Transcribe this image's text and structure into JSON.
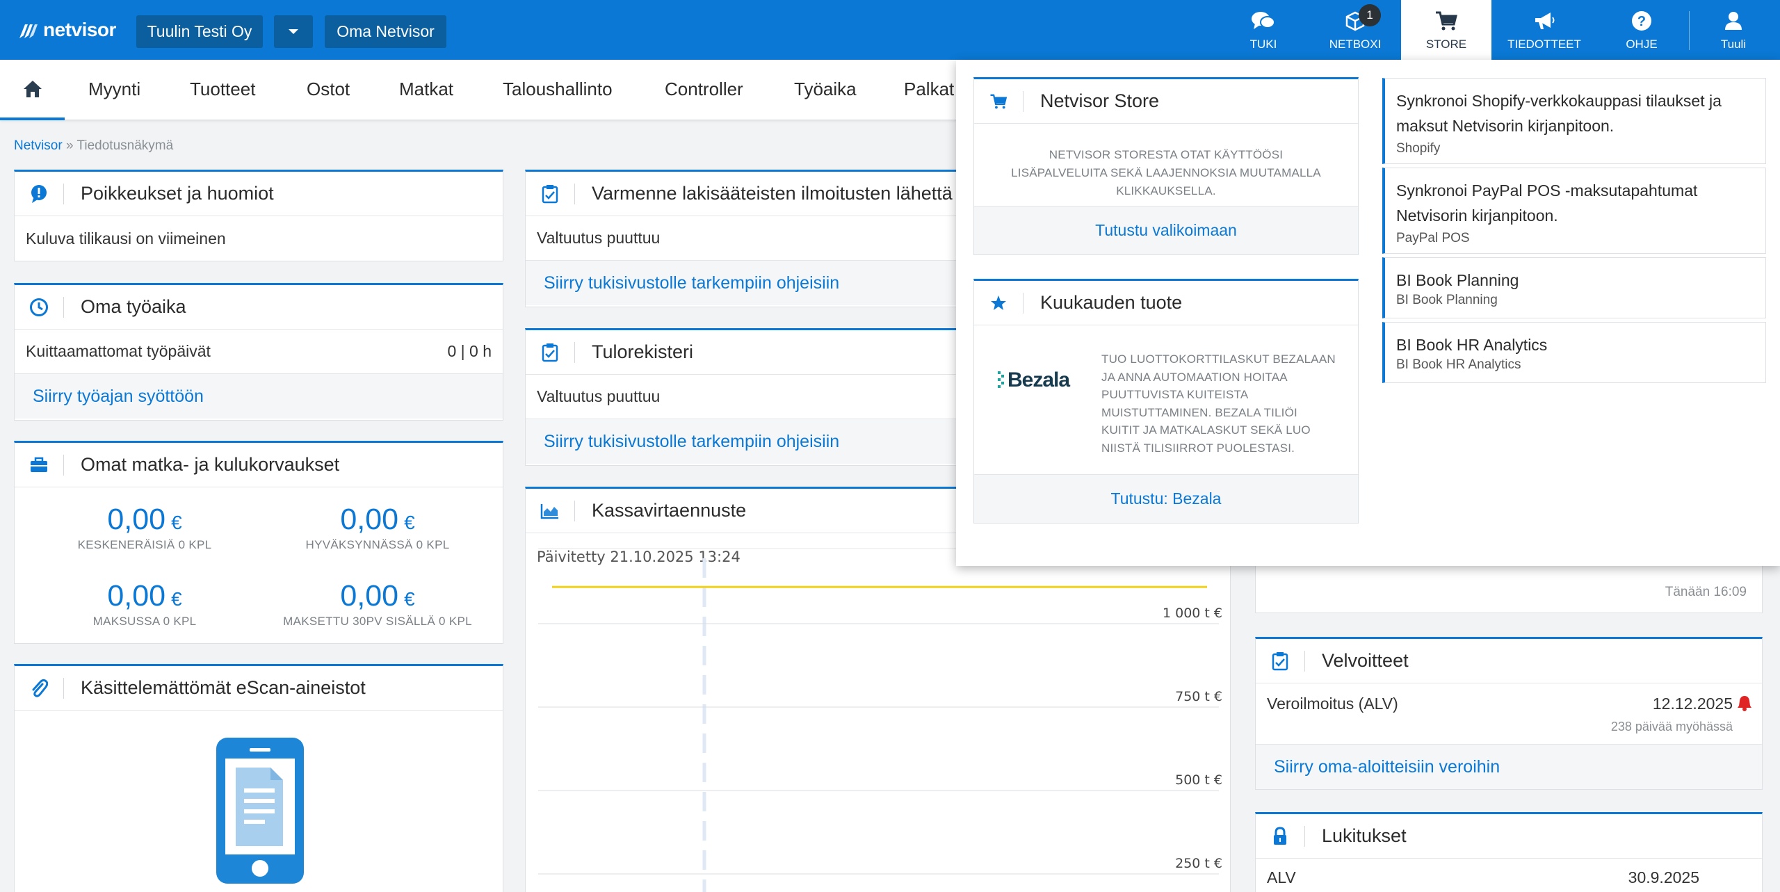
{
  "topbar": {
    "brand": "netvisor",
    "company": "Tuulin Testi Oy",
    "oma_netvisor": "Oma Netvisor",
    "nav": [
      {
        "id": "tuki",
        "label": "TUKI",
        "icon": "chat-bubbles-icon"
      },
      {
        "id": "netboxi",
        "label": "NETBOXI",
        "icon": "box-icon",
        "badge": "1"
      },
      {
        "id": "store",
        "label": "STORE",
        "icon": "cart-icon"
      },
      {
        "id": "tiedotteet",
        "label": "TIEDOTTEET",
        "icon": "megaphone-icon"
      },
      {
        "id": "ohje",
        "label": "OHJE",
        "icon": "help-icon"
      },
      {
        "id": "tuuli",
        "label": "Tuuli",
        "icon": "user-icon"
      }
    ]
  },
  "menu": [
    "Myynti",
    "Tuotteet",
    "Ostot",
    "Matkat",
    "Taloushallinto",
    "Controller",
    "Työaika",
    "Palkat"
  ],
  "breadcrumb": {
    "root": "Netvisor",
    "separator": "»",
    "current": "Tiedotusnäkymä"
  },
  "poikkeukset": {
    "title": "Poikkeukset ja huomiot",
    "row": "Kuluva tilikausi on viimeinen"
  },
  "tyoaika": {
    "title": "Oma työaika",
    "row_label": "Kuittaamattomat työpäivät",
    "row_value": "0 | 0 h",
    "link": "Siirry työajan syöttöön"
  },
  "kulukorvaukset": {
    "title": "Omat matka- ja kulukorvaukset",
    "currency": "€",
    "items": [
      {
        "amount": "0,00",
        "label": "KESKENERÄISIÄ 0 KPL"
      },
      {
        "amount": "0,00",
        "label": "HYVÄKSYNNÄSSÄ 0 KPL"
      },
      {
        "amount": "0,00",
        "label": "MAKSUSSA 0 KPL"
      },
      {
        "amount": "0,00",
        "label": "MAKSETTU 30PV SISÄLLÄ 0 KPL"
      }
    ]
  },
  "escan": {
    "title": "Käsittelemättömät eScan-aineistot"
  },
  "varmenne": {
    "title": "Varmenne lakisääteisten ilmoitusten lähettä",
    "row": "Valtuutus puuttuu",
    "link": "Siirry tukisivustolle tarkempiin ohjeisiin"
  },
  "tulorekisteri": {
    "title": "Tulorekisteri",
    "row": "Valtuutus puuttuu",
    "link": "Siirry tukisivustolle tarkempiin ohjeisiin"
  },
  "kassavirta": {
    "title": "Kassavirtaennuste",
    "updated": "Päivitetty 21.10.2025 13:24"
  },
  "chart_data": {
    "type": "line",
    "title": "Kassavirtaennuste",
    "y_tick_labels": [
      "1 000 t €",
      "750 t €",
      "500 t €",
      "250 t €"
    ],
    "y_ticks": [
      1000,
      750,
      500,
      250
    ],
    "series": [
      {
        "values": [
          1110,
          1110
        ],
        "color": "#f2d21b"
      }
    ],
    "grid": true,
    "colors": {
      "line": "#f2d21b",
      "today_marker": "#dfe9f5"
    }
  },
  "tanaan": {
    "time": "Tänään 16:09"
  },
  "velvoitteet": {
    "title": "Velvoitteet",
    "item": "Veroilmoitus (ALV)",
    "date": "12.12.2025",
    "note": "238 päivää myöhässä",
    "link": "Siirry oma-aloitteisiin veroihin"
  },
  "lukitukset": {
    "title": "Lukitukset",
    "item": "ALV",
    "date": "30.9.2025"
  },
  "store": {
    "title": "Netvisor Store",
    "desc": "NETVISOR STORESTA OTAT KÄYTTÖÖSI LISÄPALVELUITA SEKÄ LAAJENNOKSIA MUUTAMALLA KLIKKAUKSELLA.",
    "link": "Tutustu valikoimaan",
    "month_title": "Kuukauden tuote",
    "month_logo": "Bezala",
    "month_desc": "TUO LUOTTOKORTTILASKUT BEZALAAN JA ANNA AUTOMAATION HOITAA PUUTTUVISTA KUITEISTA MUISTUTTAMINEN. BEZALA TILIÖI KUITIT JA MATKALASKUT SEKÄ LUO NIISTÄ TILISIIRROT PUOLESTASI.",
    "month_link": "Tutustu: Bezala",
    "items": [
      {
        "title": "Synkronoi Shopify-verkkokauppasi tilaukset ja maksut Netvisorin kirjanpitoon.",
        "sub": "Shopify"
      },
      {
        "title": "Synkronoi PayPal POS -maksutapahtumat Netvisorin kirjanpitoon.",
        "sub": "PayPal POS"
      },
      {
        "title": "BI Book Planning",
        "sub": "BI Book Planning"
      },
      {
        "title": "BI Book HR Analytics",
        "sub": "BI Book HR Analytics"
      }
    ]
  },
  "colors": {
    "brand": "#0a78d4",
    "dark_button": "#0b5f9e",
    "alert": "#e02424"
  }
}
